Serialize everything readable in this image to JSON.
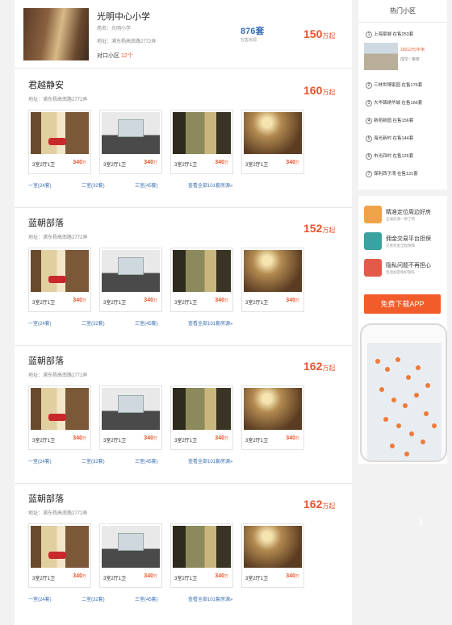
{
  "school": {
    "name": "光明中心小学",
    "line1": "简名：光明小学",
    "line2": "地址：浦东杨高南路2772弄",
    "count_prefix": "对口小区",
    "count_num": "12个",
    "homes": "876套",
    "homes_label": "在售房源",
    "price_num": "150",
    "price_unit": "万起"
  },
  "blocks": [
    {
      "title": "君越静安",
      "addr": "地址：浦东杨高南路2772弄",
      "price": "160",
      "unit": "万起"
    },
    {
      "title": "蓝朝部落",
      "addr": "地址：浦东杨高南路2772弄",
      "price": "152",
      "unit": "万起"
    },
    {
      "title": "蓝朝部落",
      "addr": "地址：浦东杨高南路2772弄",
      "price": "162",
      "unit": "万起"
    },
    {
      "title": "蓝朝部落",
      "addr": "地址：浦东杨高南路2772弄",
      "price": "162",
      "unit": "万起"
    }
  ],
  "card": {
    "layout": "3室2厅1卫",
    "price": "340",
    "unit": "万"
  },
  "links": {
    "l1": "一室(24套)",
    "l2": "二室(32套)",
    "l3": "三室(45套)",
    "l4": "查看全部101套房源»"
  },
  "hot": {
    "title": "热门小区",
    "featured_name": "上海豪城",
    "featured_count": "在售253套",
    "featured_price": "19212元/平米",
    "featured_trend": "成交↑ 审核",
    "items": [
      {
        "n": "2",
        "t": "三林世博家园 在售176套"
      },
      {
        "n": "3",
        "t": "大华锦绣华城 在售166套"
      },
      {
        "n": "4",
        "t": "新苑新园 在售156套"
      },
      {
        "n": "5",
        "t": "海光新村 在售144套"
      },
      {
        "n": "6",
        "t": "市光四村 在售126套"
      },
      {
        "n": "7",
        "t": "保利西子湾 在售121套"
      }
    ]
  },
  "app": {
    "r1t": "精准定位周边好房",
    "r1s": "全城房源一目了然",
    "r2t": "佣金交易平台担保",
    "r2s": "交易资金全程保障",
    "r3t": "隐私问题不再担心",
    "r3s": "电话加密保护隐私",
    "download": "免费下载APP"
  },
  "colors": {
    "accent": "#e8542a",
    "link": "#3a6fb0",
    "button": "#f25c2b"
  }
}
